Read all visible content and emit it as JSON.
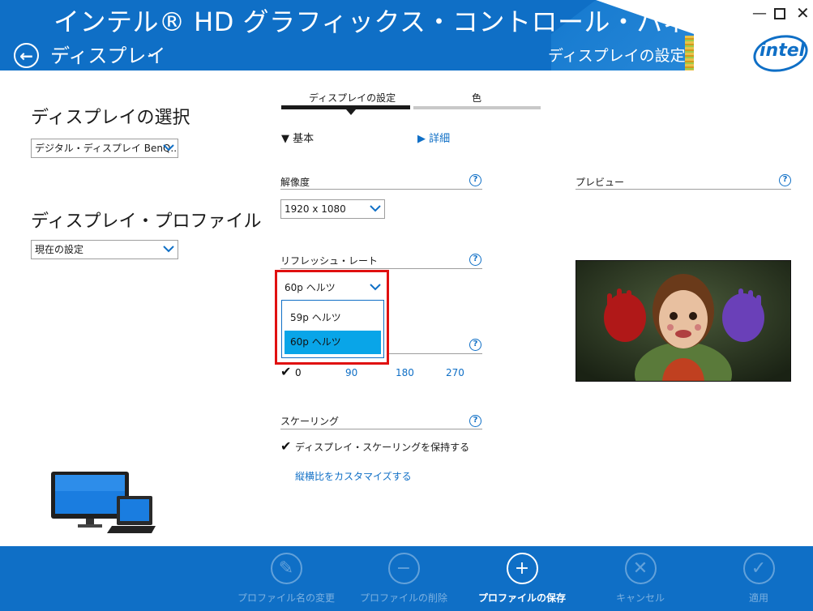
{
  "header": {
    "app_title": "インテル® HD グラフィックス・コントロール・パネル",
    "section": "ディスプレイ",
    "subtitle": "ディスプレイの設定",
    "brand": "intel"
  },
  "left": {
    "display_select_heading": "ディスプレイの選択",
    "display_select_value": "デジタル・ディスプレイ BenQ...",
    "profile_heading": "ディスプレイ・プロファイル",
    "profile_value": "現在の設定"
  },
  "tabs": [
    {
      "label": "ディスプレイの設定"
    },
    {
      "label": "色"
    }
  ],
  "modes": {
    "basic": "基本",
    "advanced": "詳細"
  },
  "resolution": {
    "label": "解像度",
    "value": "1920 x 1080"
  },
  "refresh": {
    "label": "リフレッシュ・レート",
    "value": "60p ヘルツ",
    "options": [
      "59p ヘルツ",
      "60p ヘルツ"
    ]
  },
  "rotation": {
    "options": [
      "0",
      "90",
      "180",
      "270"
    ]
  },
  "scaling": {
    "label": "スケーリング",
    "keep_option": "ディスプレイ・スケーリングを保持する",
    "customize_link": "縦横比をカスタマイズする"
  },
  "preview": {
    "label": "プレビュー"
  },
  "footer": {
    "buttons": [
      {
        "label": "プロファイル名の変更",
        "enabled": false
      },
      {
        "label": "プロファイルの削除",
        "enabled": false
      },
      {
        "label": "プロファイルの保存",
        "enabled": true
      },
      {
        "label": "キャンセル",
        "enabled": false
      },
      {
        "label": "適用",
        "enabled": false
      }
    ]
  },
  "colors": {
    "intel_blue": "#0f6fc6",
    "selection": "#09a5e8",
    "highlight_frame": "#e01010"
  }
}
